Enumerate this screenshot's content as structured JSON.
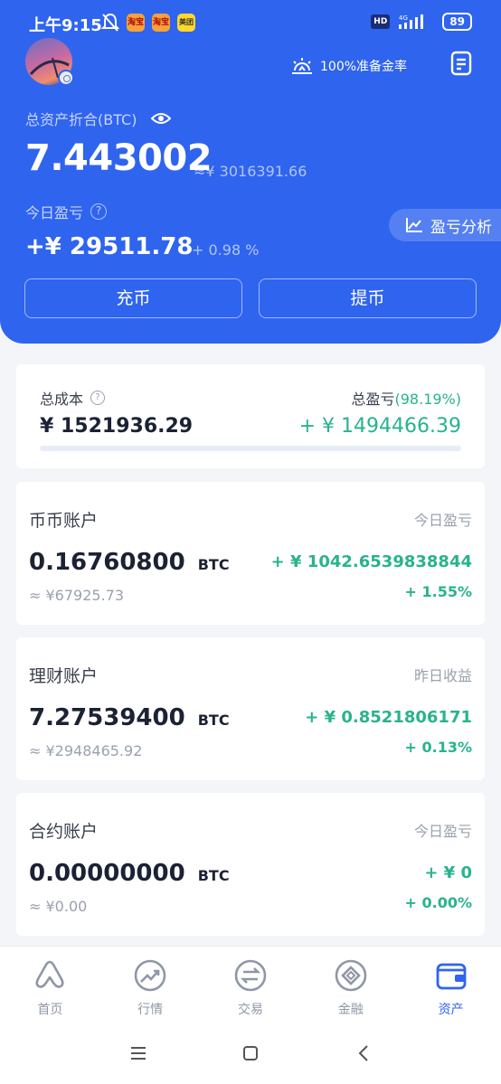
{
  "status_bar": {
    "time": "上午9:15",
    "app_icons": [
      "淘宝",
      "淘宝",
      "美团"
    ],
    "network": "4G",
    "hd": "HD",
    "battery": "89"
  },
  "header": {
    "reserve_label": "100%准备金率",
    "total_label": "总资产折合(BTC)",
    "total_value": "7.443002",
    "total_approx": "≈¥ 3016391.66",
    "today_label": "今日盈亏",
    "today_value": "+¥ 29511.78",
    "today_pct": "+ 0.98 %",
    "analysis_label": "盈亏分析",
    "deposit_label": "充币",
    "withdraw_label": "提币"
  },
  "summary": {
    "cost_label": "总成本",
    "cost_value": "¥ 1521936.29",
    "pnl_label": "总盈亏",
    "pnl_pct": "(98.19%)",
    "pnl_value": "+ ¥ 1494466.39"
  },
  "accounts": [
    {
      "title": "币币账户",
      "sub_label": "今日盈亏",
      "amount": "0.16760800",
      "unit": "BTC",
      "approx": "≈ ¥67925.73",
      "pnl": "+ ¥ 1042.6539838844",
      "pct": "+ 1.55%"
    },
    {
      "title": "理财账户",
      "sub_label": "昨日收益",
      "amount": "7.27539400",
      "unit": "BTC",
      "approx": "≈ ¥2948465.92",
      "pnl": "+ ¥ 0.8521806171",
      "pct": "+ 0.13%"
    },
    {
      "title": "合约账户",
      "sub_label": "今日盈亏",
      "amount": "0.00000000",
      "unit": "BTC",
      "approx": "≈ ¥0.00",
      "pnl": "+ ¥ 0",
      "pct": "+ 0.00%"
    }
  ],
  "bottom_nav": [
    {
      "label": "首页",
      "icon": "home-logo-icon",
      "active": false
    },
    {
      "label": "行情",
      "icon": "market-trend-icon",
      "active": false
    },
    {
      "label": "交易",
      "icon": "exchange-icon",
      "active": false
    },
    {
      "label": "金融",
      "icon": "finance-diamond-icon",
      "active": false
    },
    {
      "label": "资产",
      "icon": "wallet-icon",
      "active": true
    }
  ],
  "colors": {
    "brand_blue": "#2f64ef",
    "profit_green": "#28b38e",
    "muted_gray": "#9aa1ae"
  }
}
